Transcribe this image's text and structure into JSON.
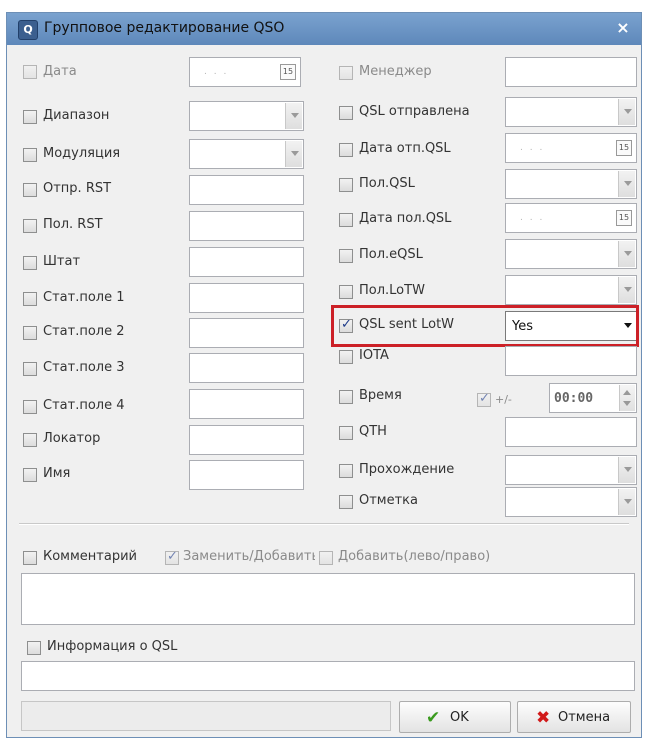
{
  "window": {
    "title": "Групповое редактирование QSO",
    "close_label": "×",
    "title_icon": "Q"
  },
  "left_fields": [
    {
      "label": "Дата",
      "placeholder": ". . ."
    },
    {
      "label": "Диапазон"
    },
    {
      "label": "Модуляция"
    },
    {
      "label": "Отпр. RST"
    },
    {
      "label": "Пол. RST"
    },
    {
      "label": "Штат"
    },
    {
      "label": "Стат.поле 1"
    },
    {
      "label": "Стат.поле 2"
    },
    {
      "label": "Стат.поле 3"
    },
    {
      "label": "Стат.поле 4"
    },
    {
      "label": "Локатор"
    },
    {
      "label": "Имя"
    }
  ],
  "right_fields": [
    {
      "label": "Менеджер"
    },
    {
      "label": "QSL отправлена"
    },
    {
      "label": "Дата отп.QSL",
      "placeholder": ". . ."
    },
    {
      "label": "Пол.QSL"
    },
    {
      "label": "Дата пол.QSL",
      "placeholder": ". . ."
    },
    {
      "label": "Пол.eQSL"
    },
    {
      "label": "Пол.LoTW"
    },
    {
      "label": "QSL sent LotW",
      "value": "Yes",
      "checked": true
    },
    {
      "label": "IOTA"
    },
    {
      "label": "Время",
      "offset_label": "+/-",
      "time_value": "00:00"
    },
    {
      "label": "QTH"
    },
    {
      "label": "Прохождение"
    },
    {
      "label": "Отметка"
    }
  ],
  "calendar_icon_text": "15",
  "comment": {
    "label": "Комментарий",
    "replace_label": "Заменить/Добавить",
    "add_label": "Добавить(лево/право)"
  },
  "qsl_info": {
    "label": "Информация о QSL"
  },
  "buttons": {
    "ok": "OK",
    "cancel": "Отмена"
  },
  "colors": {
    "highlight": "#cc2027",
    "ok_icon": "#3a9a1e",
    "cancel_icon": "#d11a1a"
  }
}
